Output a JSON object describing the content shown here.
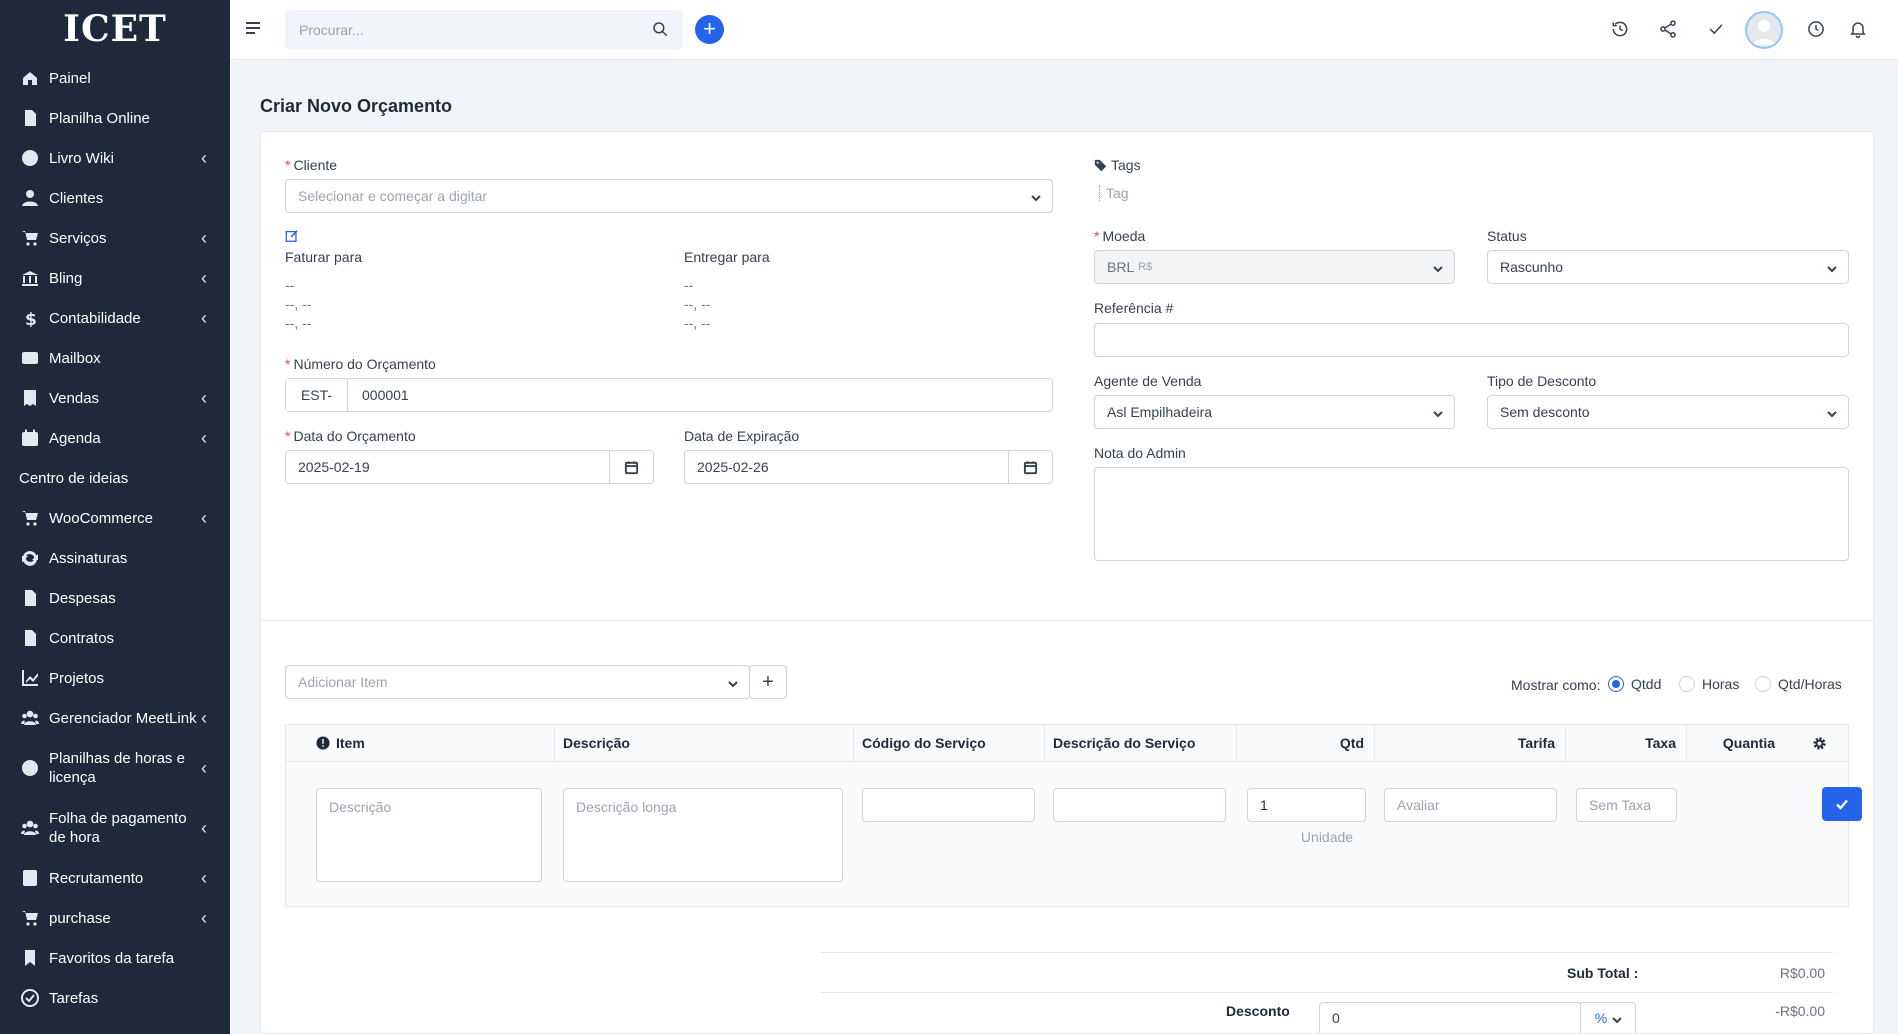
{
  "sidebar": {
    "logo": "ICET",
    "items": [
      {
        "label": "Painel",
        "icon": "home-icon",
        "sub": false
      },
      {
        "label": "Planilha Online",
        "icon": "file-icon",
        "sub": false
      },
      {
        "label": "Livro Wiki",
        "icon": "question-icon",
        "sub": true
      },
      {
        "label": "Clientes",
        "icon": "user-icon",
        "sub": false
      },
      {
        "label": "Serviços",
        "icon": "cart-icon",
        "sub": true
      },
      {
        "label": "Bling",
        "icon": "bank-icon",
        "sub": true
      },
      {
        "label": "Contabilidade",
        "icon": "dollar-icon",
        "sub": true
      },
      {
        "label": "Mailbox",
        "icon": "envelope-icon",
        "sub": false
      },
      {
        "label": "Vendas",
        "icon": "receipt-icon",
        "sub": true
      },
      {
        "label": "Agenda",
        "icon": "calendar-icon",
        "sub": true
      },
      {
        "label": "Centro de ideias",
        "icon": "",
        "sub": false
      },
      {
        "label": "WooCommerce",
        "icon": "cart-icon",
        "sub": true
      },
      {
        "label": "Assinaturas",
        "icon": "refresh-icon",
        "sub": false
      },
      {
        "label": "Despesas",
        "icon": "file-icon",
        "sub": false
      },
      {
        "label": "Contratos",
        "icon": "file-icon",
        "sub": false
      },
      {
        "label": "Projetos",
        "icon": "chart-icon",
        "sub": false
      },
      {
        "label": "Gerenciador MeetLink",
        "icon": "users-icon",
        "sub": true
      },
      {
        "label": "Planilhas de horas e licença",
        "icon": "user-circle-icon",
        "sub": true
      },
      {
        "label": "Folha de pagamento de hora",
        "icon": "users-icon",
        "sub": true
      },
      {
        "label": "Recrutamento",
        "icon": "id-card-icon",
        "sub": true
      },
      {
        "label": "purchase",
        "icon": "cart-icon",
        "sub": true
      },
      {
        "label": "Favoritos da tarefa",
        "icon": "bookmark-icon",
        "sub": false
      },
      {
        "label": "Tarefas",
        "icon": "check-circle-icon",
        "sub": false
      }
    ]
  },
  "topbar": {
    "search_placeholder": "Procurar..."
  },
  "page": {
    "title": "Criar Novo Orçamento"
  },
  "form": {
    "cliente_label": "Cliente",
    "cliente_placeholder": "Selecionar e começar a digitar",
    "faturar_label": "Faturar para",
    "entregar_label": "Entregar para",
    "addr_line1": "--",
    "addr_line2": "--, --",
    "addr_line3": "--, --",
    "numero_label": "Número do Orçamento",
    "numero_prefix": "EST-",
    "numero_value": "000001",
    "data_label": "Data do Orçamento",
    "data_value": "2025-02-19",
    "expiracao_label": "Data de Expiração",
    "expiracao_value": "2025-02-26",
    "tags_label": "Tags",
    "tags_placeholder": "Tag",
    "moeda_label": "Moeda",
    "moeda_value": "BRL",
    "moeda_symbol": "R$",
    "status_label": "Status",
    "status_value": "Rascunho",
    "referencia_label": "Referência #",
    "agente_label": "Agente de Venda",
    "agente_value": "Asl Empilhadeira",
    "desconto_tipo_label": "Tipo de Desconto",
    "desconto_tipo_value": "Sem desconto",
    "nota_label": "Nota do Admin"
  },
  "items": {
    "add_placeholder": "Adicionar Item",
    "show_as_label": "Mostrar como:",
    "show_options": [
      "Qtdd",
      "Horas",
      "Qtd/Horas"
    ],
    "selected_option": "Qtdd",
    "columns": [
      "Item",
      "Descrição",
      "Código do Serviço",
      "Descrição do Serviço",
      "Qtd",
      "Tarifa",
      "Taxa",
      "Quantia"
    ],
    "row": {
      "desc_placeholder": "Descrição",
      "long_desc_placeholder": "Descrição longa",
      "qty_value": "1",
      "unit_label": "Unidade",
      "rate_placeholder": "Avaliar",
      "tax_value": "Sem Taxa"
    }
  },
  "totals": {
    "subtotal_label": "Sub Total :",
    "subtotal_value": "R$0.00",
    "discount_label": "Desconto",
    "discount_input": "0",
    "discount_unit": "%",
    "discount_value": "-R$0.00"
  },
  "colors": {
    "sidebar_bg": "#1e293b",
    "accent": "#2563eb",
    "required": "#ef4444"
  }
}
